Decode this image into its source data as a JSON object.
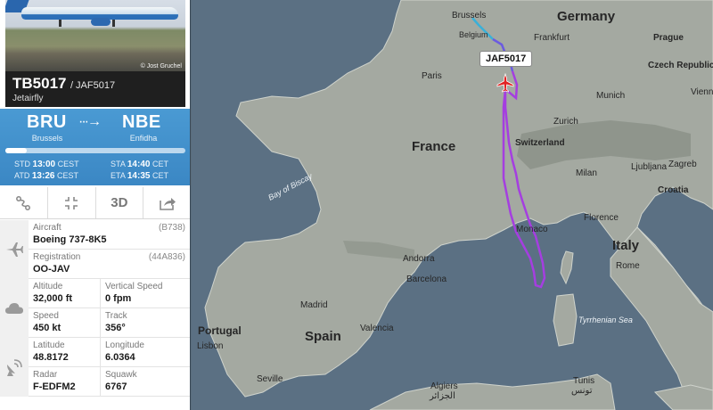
{
  "photo": {
    "credit": "© Jost Gruchel"
  },
  "flight": {
    "number": "TB5017",
    "alt_number": "/ JAF5017",
    "airline": "Jetairfly"
  },
  "route": {
    "origin_code": "BRU",
    "origin_city": "Brussels",
    "dest_code": "NBE",
    "dest_city": "Enfidha",
    "progress": 0.12,
    "std_label": "STD",
    "std": "13:00",
    "std_tz": "CEST",
    "atd_label": "ATD",
    "atd": "13:26",
    "atd_tz": "CEST",
    "sta_label": "STA",
    "sta": "14:40",
    "sta_tz": "CET",
    "eta_label": "ETA",
    "eta": "14:35",
    "eta_tz": "CET"
  },
  "toolbar": {
    "view_3d": "3D",
    "icons": [
      "route-icon",
      "fullscreen-icon",
      "3d-view",
      "share-icon"
    ]
  },
  "details": {
    "aircraft_label": "Aircraft",
    "aircraft": "Boeing 737-8K5",
    "aircraft_code": "(B738)",
    "registration_label": "Registration",
    "registration": "OO-JAV",
    "registration_code": "(44A836)",
    "altitude_label": "Altitude",
    "altitude": "32,000 ft",
    "vspeed_label": "Vertical Speed",
    "vspeed": "0 fpm",
    "speed_label": "Speed",
    "speed": "450 kt",
    "track_label": "Track",
    "track": "356°",
    "lat_label": "Latitude",
    "lat": "48.8172",
    "lon_label": "Longitude",
    "lon": "6.0364",
    "radar_label": "Radar",
    "radar": "F-EDFM2",
    "squawk_label": "Squawk",
    "squawk": "6767"
  },
  "map": {
    "callout": "JAF5017",
    "countries": [
      "Germany",
      "France",
      "Italy",
      "Spain",
      "Portugal"
    ],
    "cities": [
      "Brussels",
      "Belgium",
      "Frankfurt",
      "Prague",
      "Czech Republic",
      "Paris",
      "Munich",
      "Vienna",
      "Switzerland",
      "Zurich",
      "Ljubljana",
      "Zagreb",
      "Croatia",
      "Milan",
      "Monaco",
      "Florence",
      "Andorra",
      "Rome",
      "Barcelona",
      "Madrid",
      "Valencia",
      "Lisbon",
      "Seville",
      "Algiers",
      "الجزائر",
      "Tunis",
      "تونس"
    ],
    "seas": [
      "Bay of Biscay",
      "Tyrrhenian Sea"
    ],
    "colors": {
      "sea": "#5b7083",
      "land": "#a4a9a1",
      "track": "#a53ee0",
      "track_start": "#3ab0d8"
    }
  }
}
